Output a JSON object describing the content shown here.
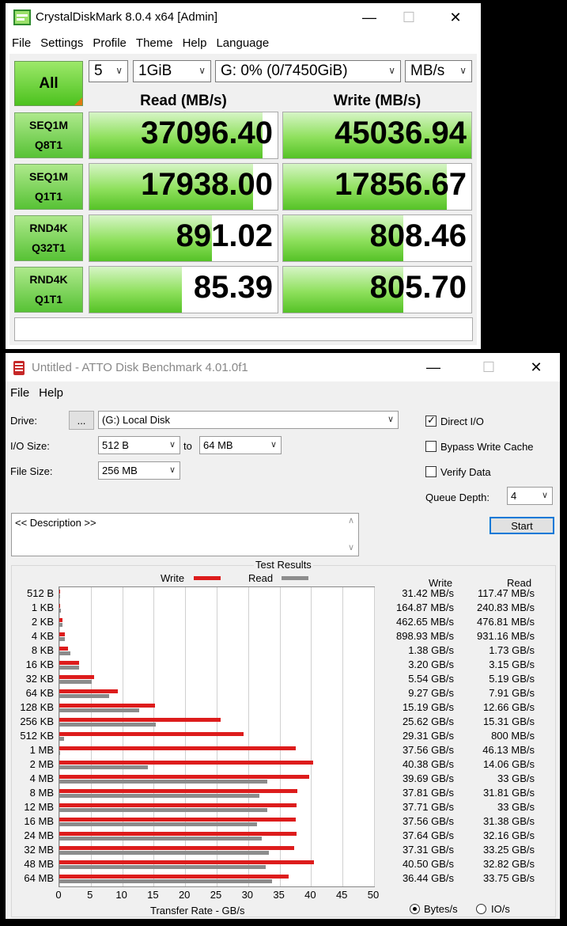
{
  "crystal": {
    "title": "CrystalDiskMark 8.0.4 x64 [Admin]",
    "menu": [
      "File",
      "Settings",
      "Profile",
      "Theme",
      "Help",
      "Language"
    ],
    "all_label": "All",
    "count": "5",
    "size": "1GiB",
    "drive": "G: 0% (0/7450GiB)",
    "unit": "MB/s",
    "read_header": "Read (MB/s)",
    "write_header": "Write (MB/s)",
    "tests": [
      {
        "line1": "SEQ1M",
        "line2": "Q8T1",
        "read": "37096.40",
        "write": "45036.94",
        "read_fill": 0.92,
        "write_fill": 1.0
      },
      {
        "line1": "SEQ1M",
        "line2": "Q1T1",
        "read": "17938.00",
        "write": "17856.67",
        "read_fill": 0.87,
        "write_fill": 0.87
      },
      {
        "line1": "RND4K",
        "line2": "Q32T1",
        "read": "891.02",
        "write": "808.46",
        "read_fill": 0.65,
        "write_fill": 0.64
      },
      {
        "line1": "RND4K",
        "line2": "Q1T1",
        "read": "85.39",
        "write": "805.70",
        "read_fill": 0.49,
        "write_fill": 0.64
      }
    ],
    "status": ""
  },
  "atto": {
    "title": "Untitled - ATTO Disk Benchmark 4.01.0f1",
    "menu": [
      "File",
      "Help"
    ],
    "drive_label": "Drive:",
    "browse_label": "...",
    "drive_value": "(G:) Local Disk",
    "io_label": "I/O Size:",
    "io_from": "512 B",
    "io_to_label": "to",
    "io_to": "64 MB",
    "file_size_label": "File Size:",
    "file_size": "256 MB",
    "direct_io_label": "Direct I/O",
    "direct_io_checked": true,
    "bypass_label": "Bypass Write Cache",
    "bypass_checked": false,
    "verify_label": "Verify Data",
    "verify_checked": false,
    "queue_label": "Queue Depth:",
    "queue_value": "4",
    "start_label": "Start",
    "description": "<< Description >>",
    "results_title": "Test Results",
    "legend_write": "Write",
    "legend_read": "Read",
    "col_write": "Write",
    "col_read": "Read",
    "x_axis_label": "Transfer Rate - GB/s",
    "x_ticks": [
      "0",
      "5",
      "10",
      "15",
      "20",
      "25",
      "30",
      "35",
      "40",
      "45",
      "50"
    ],
    "units_bytes": "Bytes/s",
    "units_io": "IO/s",
    "units_selected": "Bytes/s",
    "colors": {
      "write": "#dd1c1c",
      "read": "#8c8c8c"
    }
  },
  "chart_data": {
    "type": "bar",
    "orientation": "horizontal",
    "title": "Test Results",
    "xlabel": "Transfer Rate - GB/s",
    "xlim": [
      0,
      50
    ],
    "categories": [
      "512 B",
      "1 KB",
      "2 KB",
      "4 KB",
      "8 KB",
      "16 KB",
      "32 KB",
      "64 KB",
      "128 KB",
      "256 KB",
      "512 KB",
      "1 MB",
      "2 MB",
      "4 MB",
      "8 MB",
      "12 MB",
      "16 MB",
      "24 MB",
      "32 MB",
      "48 MB",
      "64 MB"
    ],
    "series": [
      {
        "name": "Write",
        "values": [
          0.03142,
          0.16487,
          0.46265,
          0.89893,
          1.38,
          3.2,
          5.54,
          9.27,
          15.19,
          25.62,
          29.31,
          37.56,
          40.38,
          39.69,
          37.81,
          37.71,
          37.56,
          37.64,
          37.31,
          40.5,
          36.44
        ]
      },
      {
        "name": "Read",
        "values": [
          0.11747,
          0.24083,
          0.47681,
          0.93116,
          1.73,
          3.15,
          5.19,
          7.91,
          12.66,
          15.31,
          0.8,
          0.04613,
          14.06,
          33,
          31.81,
          33,
          31.38,
          32.16,
          33.25,
          32.82,
          33.75
        ]
      }
    ],
    "write_text": [
      "31.42 MB/s",
      "164.87 MB/s",
      "462.65 MB/s",
      "898.93 MB/s",
      "1.38 GB/s",
      "3.20 GB/s",
      "5.54 GB/s",
      "9.27 GB/s",
      "15.19 GB/s",
      "25.62 GB/s",
      "29.31 GB/s",
      "37.56 GB/s",
      "40.38 GB/s",
      "39.69 GB/s",
      "37.81 GB/s",
      "37.71 GB/s",
      "37.56 GB/s",
      "37.64 GB/s",
      "37.31 GB/s",
      "40.50 GB/s",
      "36.44 GB/s"
    ],
    "read_text": [
      "117.47 MB/s",
      "240.83 MB/s",
      "476.81 MB/s",
      "931.16 MB/s",
      "1.73 GB/s",
      "3.15 GB/s",
      "5.19 GB/s",
      "7.91 GB/s",
      "12.66 GB/s",
      "15.31 GB/s",
      "800 MB/s",
      "46.13 MB/s",
      "14.06 GB/s",
      "33 GB/s",
      "31.81 GB/s",
      "33 GB/s",
      "31.38 GB/s",
      "32.16 GB/s",
      "33.25 GB/s",
      "32.82 GB/s",
      "33.75 GB/s"
    ],
    "grid": true,
    "legend": "top-center"
  }
}
